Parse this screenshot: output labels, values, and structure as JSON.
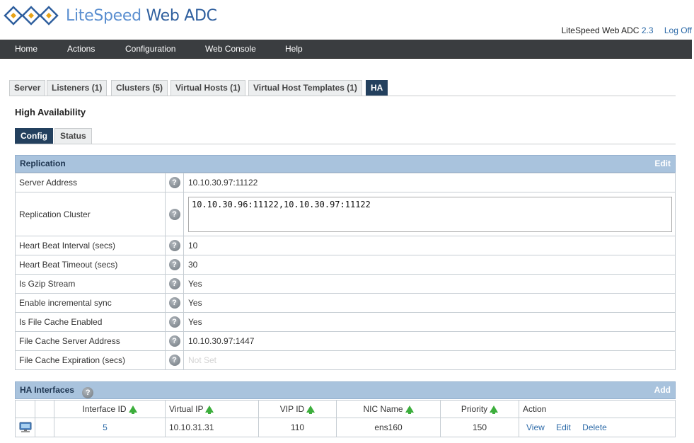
{
  "brand": {
    "logo_text_part1": "LiteSpeed",
    "logo_text_part2": "Web ADC"
  },
  "header": {
    "product": "LiteSpeed Web ADC",
    "version": "2.3",
    "logoff": "Log Off"
  },
  "nav": [
    "Home",
    "Actions",
    "Configuration",
    "Web Console",
    "Help"
  ],
  "tabs": [
    {
      "label": "Server",
      "active": false
    },
    {
      "label": "Listeners (1)",
      "active": false
    },
    {
      "label": "Clusters (5)",
      "active": false
    },
    {
      "label": "Virtual Hosts (1)",
      "active": false
    },
    {
      "label": "Virtual Host Templates (1)",
      "active": false
    },
    {
      "label": "HA",
      "active": true
    }
  ],
  "page_title": "High Availability",
  "subtabs": [
    {
      "label": "Config",
      "active": true
    },
    {
      "label": "Status",
      "active": false
    }
  ],
  "replication": {
    "title": "Replication",
    "edit_label": "Edit",
    "help_icon": "question-circle-icon",
    "rows": [
      {
        "label": "Server Address",
        "value": "10.10.30.97:11122"
      },
      {
        "label": "Replication Cluster",
        "value": "10.10.30.96:11122,10.10.30.97:11122"
      },
      {
        "label": "Heart Beat Interval (secs)",
        "value": "10"
      },
      {
        "label": "Heart Beat Timeout (secs)",
        "value": "30"
      },
      {
        "label": "Is Gzip Stream",
        "value": "Yes"
      },
      {
        "label": "Enable incremental sync",
        "value": "Yes"
      },
      {
        "label": "Is File Cache Enabled",
        "value": "Yes"
      },
      {
        "label": "File Cache Server Address",
        "value": "10.10.30.97:1447"
      },
      {
        "label": "File Cache Expiration (secs)",
        "value": "Not Set"
      }
    ]
  },
  "ha_interfaces": {
    "title": "HA Interfaces",
    "add_label": "Add",
    "columns": [
      "Interface ID",
      "Virtual IP",
      "VIP ID",
      "NIC Name",
      "Priority",
      "Action"
    ],
    "rows": [
      {
        "icon": "network-monitor-icon",
        "interface_id": "5",
        "virtual_ip": "10.10.31.31",
        "vip_id": "110",
        "nic_name": "ens160",
        "priority": "150",
        "actions": [
          "View",
          "Edit",
          "Delete"
        ]
      }
    ]
  },
  "colors": {
    "navbar": "#3a3d40",
    "active_tab": "#23405e",
    "panel_header": "#a9c3dd",
    "link": "#2c6aa8",
    "sort_arrow": "#3cae3c"
  }
}
